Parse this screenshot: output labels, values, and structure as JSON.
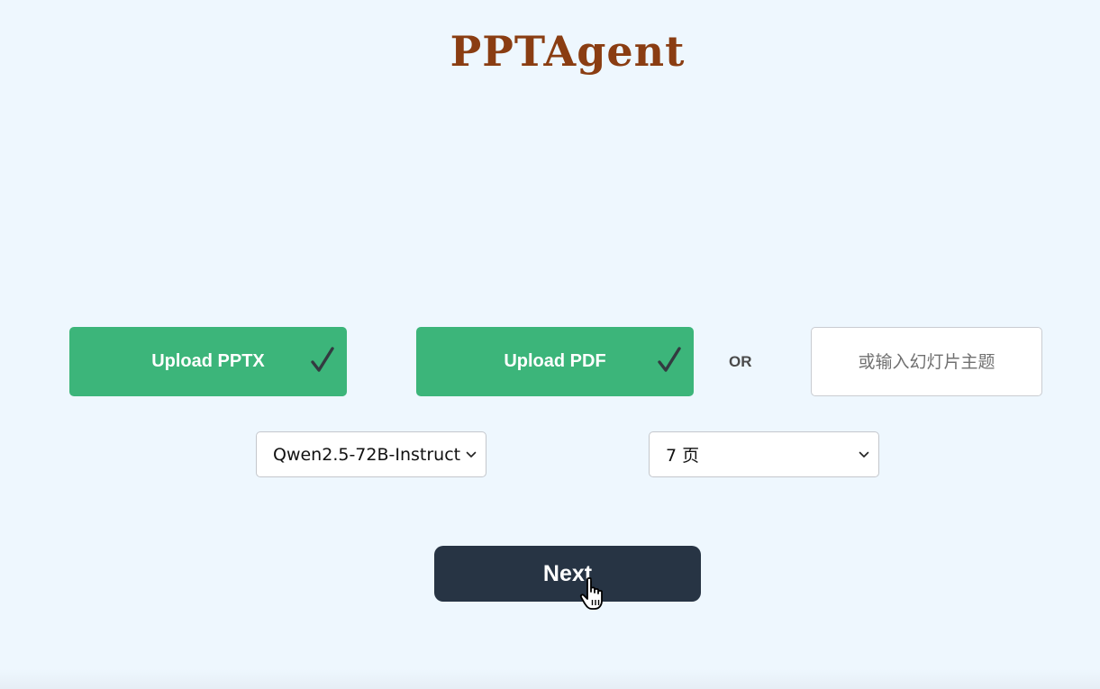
{
  "app": {
    "title": "PPTAgent"
  },
  "uploads": {
    "pptx_label": "Upload PPTX",
    "pptx_done": true,
    "pdf_label": "Upload PDF",
    "pdf_done": true
  },
  "or_label": "OR",
  "topic": {
    "placeholder": "或输入幻灯片主题",
    "value": ""
  },
  "model_select": {
    "selected": "Qwen2.5-72B-Instruct"
  },
  "pages_select": {
    "selected": "7 页"
  },
  "next_button": {
    "label": "Next"
  },
  "icons": {
    "upload_status": "checkmark-icon",
    "select_toggle": "chevron-down-icon",
    "pointer": "hand-pointer-icon"
  },
  "colors": {
    "title": "#8a3d12",
    "upload_button": "#3cb57a",
    "next_button": "#273444",
    "background": "#eef7fe"
  }
}
